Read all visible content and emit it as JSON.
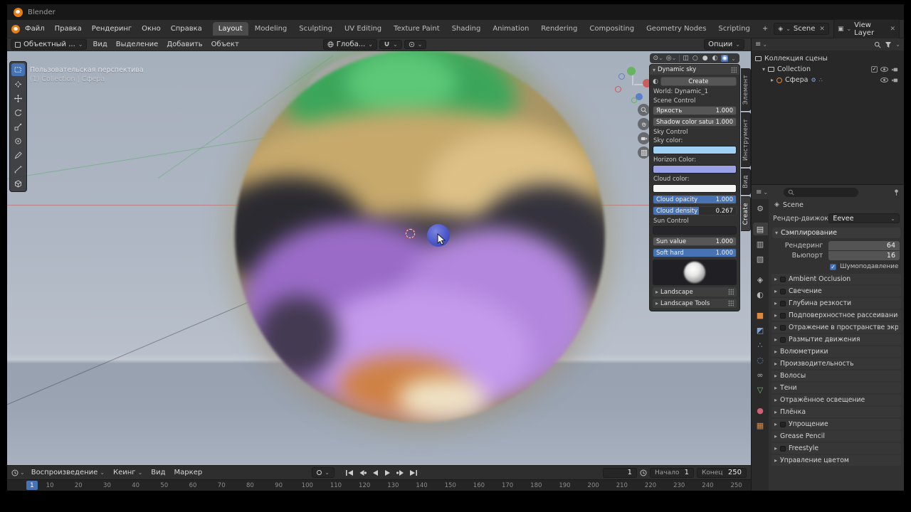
{
  "window": {
    "title": "Blender"
  },
  "menubar": {
    "menus": [
      {
        "label": "Файл"
      },
      {
        "label": "Правка"
      },
      {
        "label": "Рендеринг"
      },
      {
        "label": "Окно"
      },
      {
        "label": "Справка"
      }
    ],
    "workspaces": [
      {
        "label": "Layout",
        "active": true
      },
      {
        "label": "Modeling"
      },
      {
        "label": "Sculpting"
      },
      {
        "label": "UV Editing"
      },
      {
        "label": "Texture Paint"
      },
      {
        "label": "Shading"
      },
      {
        "label": "Animation"
      },
      {
        "label": "Rendering"
      },
      {
        "label": "Compositing"
      },
      {
        "label": "Geometry Nodes"
      },
      {
        "label": "Scripting"
      },
      {
        "label": "+"
      }
    ],
    "scene_value": "Scene",
    "view_layer_value": "View Layer"
  },
  "viewport": {
    "mode": "Объектный ...",
    "menus": [
      {
        "label": "Вид"
      },
      {
        "label": "Выделение"
      },
      {
        "label": "Добавить"
      },
      {
        "label": "Объект"
      }
    ],
    "orientation": "Глоба...",
    "options": "Опции",
    "overlay_line1": "Пользовательская перспектива",
    "overlay_line2": "(1) Collection | Сфера"
  },
  "sidebar": {
    "title": "Dynamic sky",
    "create_label": "Create",
    "world": "World: Dynamic_1",
    "scene_control_label": "Scene Control",
    "sky_control_label": "Sky Control",
    "sun_control_label": "Sun Control",
    "sky_color_label": "Sky color:",
    "horizon_color_label": "Horizon Color:",
    "cloud_color_label": "Cloud color:",
    "rows": {
      "brightness": {
        "label": "Яркость",
        "value": "1.000"
      },
      "shadow": {
        "label": "Shadow color saturatio",
        "value": "1.000"
      },
      "cloud_opacity": {
        "label": "Cloud opacity",
        "value": "1.000"
      },
      "cloud_density": {
        "label": "Cloud density",
        "value": "0.267"
      },
      "sun_value": {
        "label": "Sun value",
        "value": "1.000"
      },
      "soft_hard": {
        "label": "Soft hard",
        "value": "1.000"
      }
    },
    "swatches": {
      "sky": "#9ed1f4",
      "horizon": "#9aa1e6",
      "cloud": "#f4f4f4",
      "sun": "#26262a"
    },
    "panels": [
      "Landscape",
      "Landscape Tools"
    ],
    "tabs": [
      {
        "label": "Элемент"
      },
      {
        "label": "Инструмент"
      },
      {
        "label": "Вид"
      },
      {
        "label": "Create",
        "active": true
      }
    ]
  },
  "outliner": {
    "scene_collection": "Коллекция сцены",
    "collection": "Collection",
    "object": "Сфера"
  },
  "properties": {
    "breadcrumb": "Scene",
    "engine_label": "Рендер-движок",
    "engine_value": "Eevee",
    "sampling_title": "Сэмплирование",
    "sampling_render_label": "Рендеринг",
    "sampling_render_value": "64",
    "sampling_viewport_label": "Вьюпорт",
    "sampling_viewport_value": "16",
    "denoise_label": "Шумоподавление вьюпор...",
    "tabs": [
      {
        "name": "tool-properties-tab",
        "glyph": "⚙",
        "color": "#b8b8b8"
      },
      {
        "name": "render-properties-tab",
        "glyph": "▤",
        "color": "#d8d8d8",
        "active": true
      },
      {
        "name": "output-properties-tab",
        "glyph": "▥",
        "color": "#b8b8b8"
      },
      {
        "name": "view-layer-properties-tab",
        "glyph": "▧",
        "color": "#b8b8b8"
      },
      {
        "name": "scene-properties-tab",
        "glyph": "◈",
        "color": "#b8b8b8"
      },
      {
        "name": "world-properties-tab",
        "glyph": "◐",
        "color": "#b8b8b8"
      },
      {
        "name": "object-properties-tab",
        "glyph": "■",
        "color": "#e0873c"
      },
      {
        "name": "modifiers-properties-tab",
        "glyph": "◩",
        "color": "#7aa2d8"
      },
      {
        "name": "particles-properties-tab",
        "glyph": "∴",
        "color": "#7aa2d8"
      },
      {
        "name": "physics-properties-tab",
        "glyph": "◌",
        "color": "#7aa2d8"
      },
      {
        "name": "constraints-properties-tab",
        "glyph": "∞",
        "color": "#b8b8b8"
      },
      {
        "name": "object-data-properties-tab",
        "glyph": "▽",
        "color": "#6fbf6f"
      },
      {
        "name": "material-properties-tab",
        "glyph": "●",
        "color": "#cf5f72"
      },
      {
        "name": "texture-properties-tab",
        "glyph": "▦",
        "color": "#d88a4a"
      }
    ],
    "sections": [
      {
        "label": "Ambient Occlusion",
        "checkbox": true
      },
      {
        "label": "Свечение",
        "checkbox": true
      },
      {
        "label": "Глубина резкости",
        "checkbox": true
      },
      {
        "label": "Подповерхностное рассеивание",
        "checkbox": true
      },
      {
        "label": "Отражение в пространстве экрана",
        "checkbox": true
      },
      {
        "label": "Размытие движения",
        "checkbox": true
      },
      {
        "label": "Волюметрики"
      },
      {
        "label": "Производительность"
      },
      {
        "label": "Волосы"
      },
      {
        "label": "Тени"
      },
      {
        "label": "Отражённое освещение"
      },
      {
        "label": "Плёнка"
      },
      {
        "label": "Упрощение",
        "checkbox": true
      },
      {
        "label": "Grease Pencil"
      },
      {
        "label": "Freestyle",
        "checkbox": true
      },
      {
        "label": "Управление цветом"
      }
    ]
  },
  "timeline": {
    "menus": [
      {
        "label": "Воспроизведение",
        "dd": true
      },
      {
        "label": "Кеинг",
        "dd": true
      },
      {
        "label": "Вид"
      },
      {
        "label": "Маркер"
      }
    ],
    "current_frame": "1",
    "start_label": "Начало",
    "start_value": "1",
    "end_label": "Конец",
    "end_value": "250",
    "ticks": [
      "10",
      "20",
      "30",
      "40",
      "50",
      "60",
      "70",
      "80",
      "90",
      "100",
      "110",
      "120",
      "130",
      "140",
      "150",
      "160",
      "170",
      "180",
      "190",
      "200",
      "210",
      "220",
      "230",
      "240",
      "250"
    ]
  }
}
